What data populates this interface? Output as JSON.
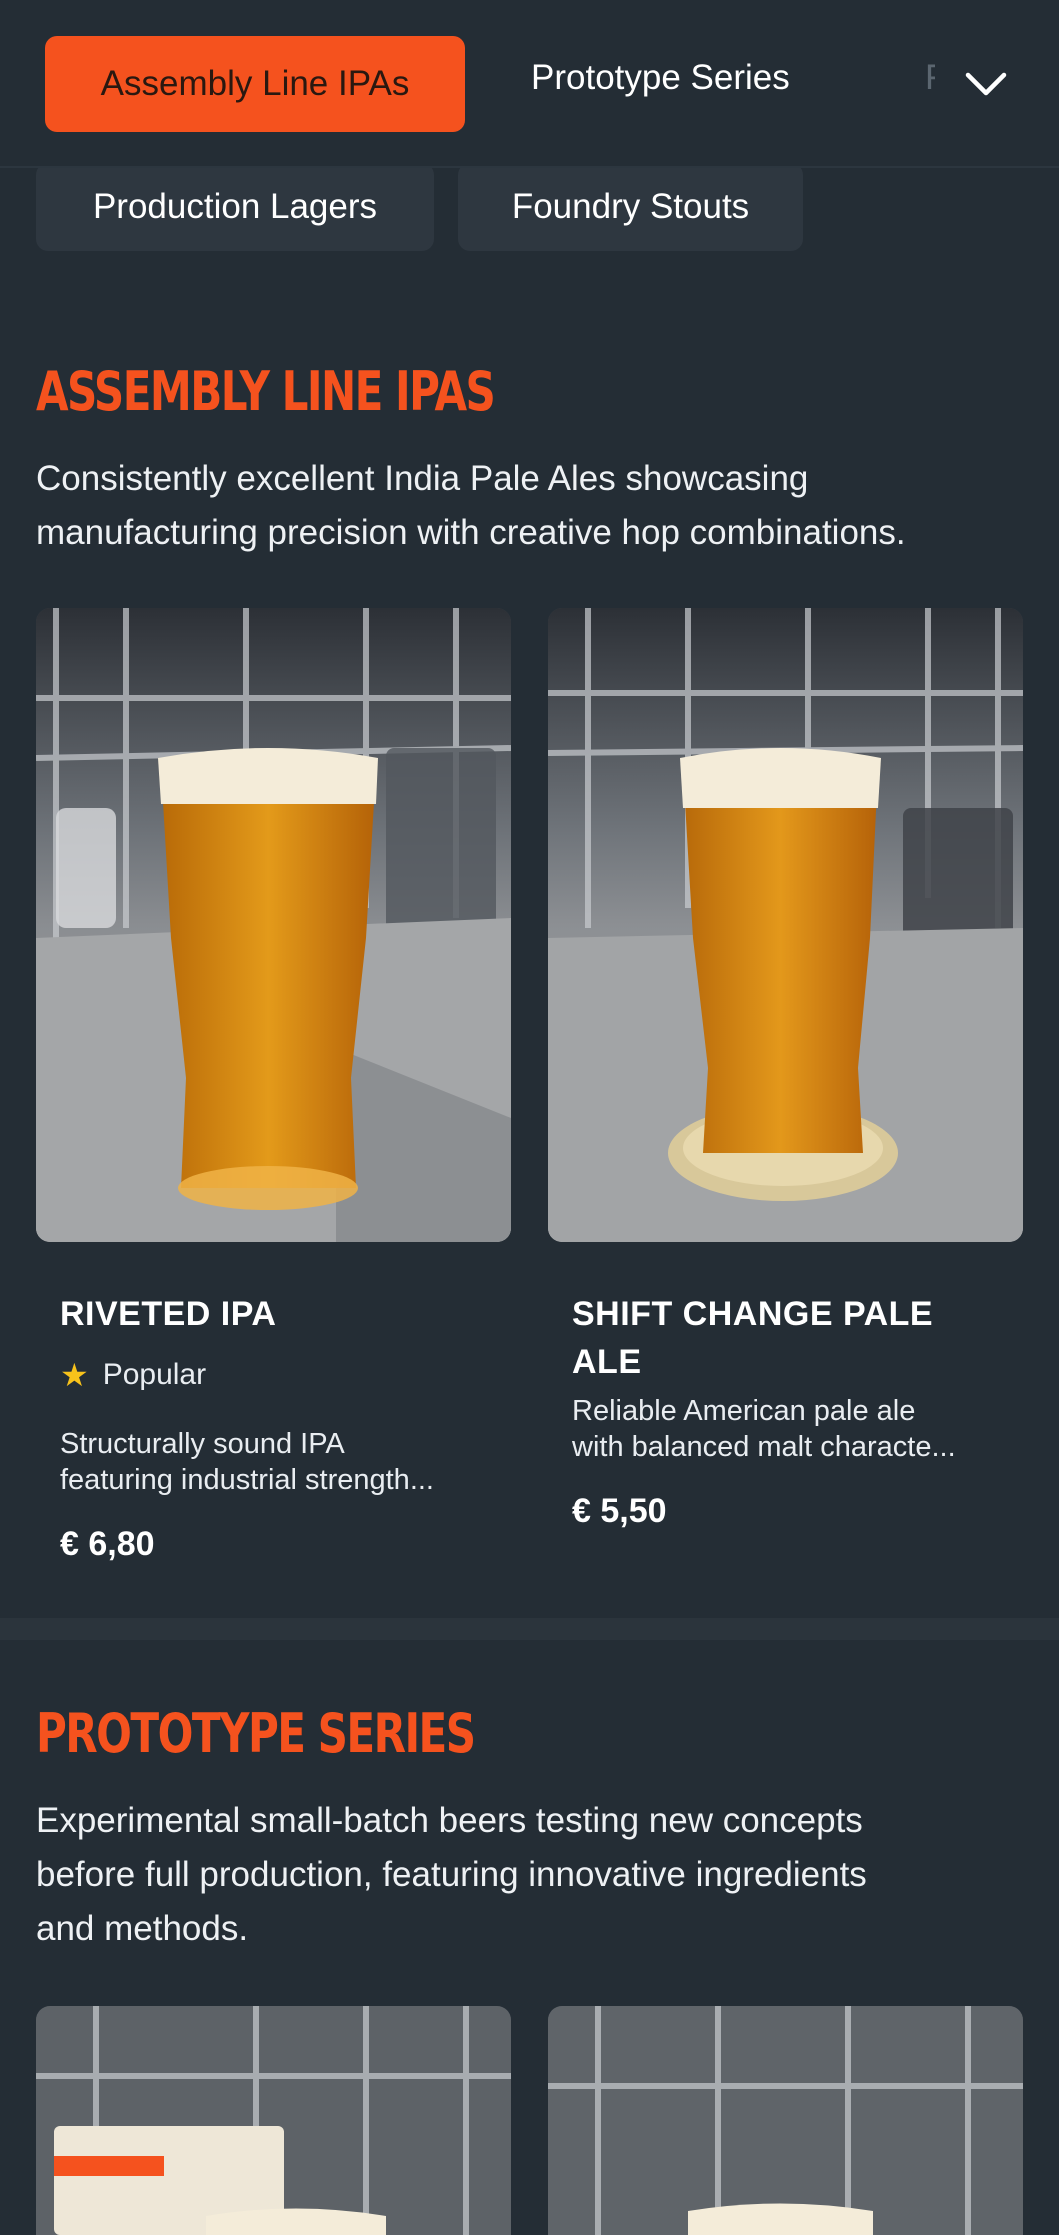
{
  "nav": {
    "active_tab": "Assembly Line IPAs",
    "tabs": [
      "Prototype Series",
      "F"
    ],
    "chips": [
      "Production Lagers",
      "Foundry Stouts"
    ],
    "expand_icon": "chevron-down-icon",
    "accent_color": "#f5521e"
  },
  "sections": [
    {
      "title": "ASSEMBLY LINE IPAS",
      "description": "Consistently excellent India Pale Ales showcasing manufacturing precision with creative hop combinations.",
      "products": [
        {
          "name": "RIVETED IPA",
          "badge": "Popular",
          "badge_icon": "star-icon",
          "description_lines": [
            "Structurally sound IPA",
            "featuring industrial strength..."
          ],
          "price": "€ 6,80"
        },
        {
          "name_lines": [
            "SHIFT CHANGE PALE",
            "ALE"
          ],
          "description_lines": [
            "Reliable American pale ale",
            "with balanced malt characte..."
          ],
          "price": "€ 5,50"
        }
      ]
    },
    {
      "title": "PROTOTYPE SERIES",
      "description_lines": [
        "Experimental small-batch beers testing new concepts",
        "before full production, featuring innovative ingredients",
        "and methods."
      ]
    }
  ]
}
